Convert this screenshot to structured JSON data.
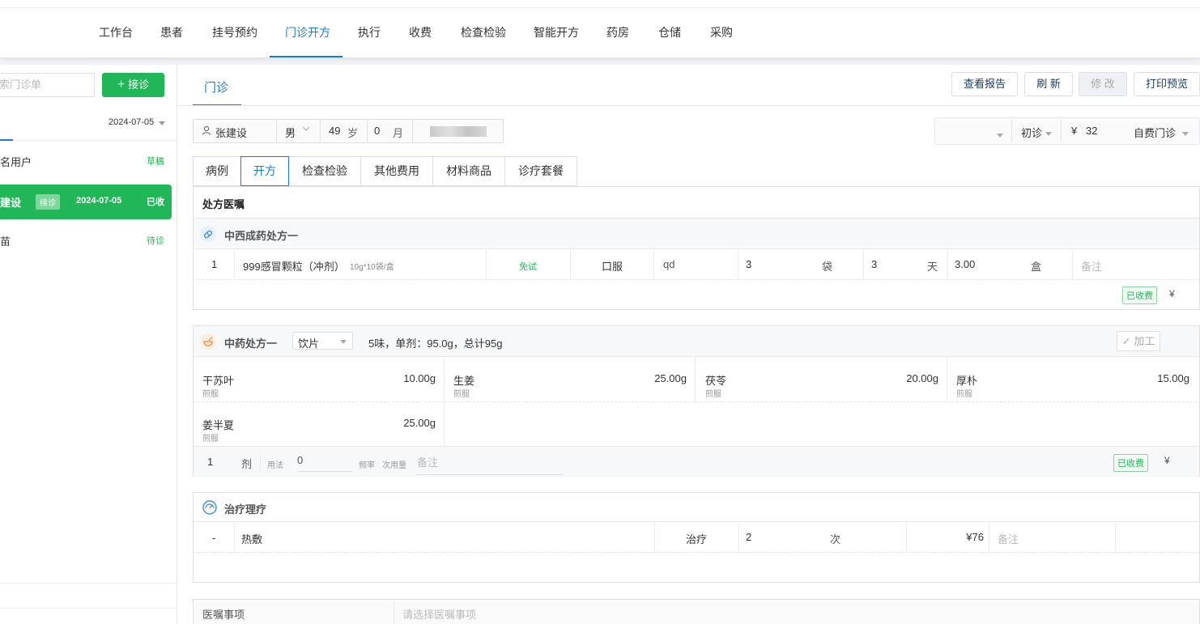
{
  "nav": {
    "items": [
      "工作台",
      "患者",
      "挂号预约",
      "门诊开方",
      "执行",
      "收费",
      "检查检验",
      "智能开方",
      "药房",
      "仓储",
      "采购"
    ],
    "active_index": 3
  },
  "sidebar": {
    "search_placeholder": "搜索门诊单",
    "receive_label": "接诊",
    "date": "2024-07-05",
    "patients": [
      {
        "name": "匿名用户",
        "status": "草稿"
      },
      {
        "name": "张建设",
        "badge": "续诊",
        "date": "2024-07-05",
        "status": "已收"
      },
      {
        "name": "张苗",
        "status": "待诊"
      }
    ]
  },
  "main": {
    "tab": "门诊",
    "buttons": {
      "report": "查看报告",
      "refresh": "刷 新",
      "modify": "修 改",
      "print": "打印预览"
    },
    "patient": {
      "name": "张建设",
      "sex": "男",
      "age": "49",
      "age_unit": "岁",
      "months": "0",
      "month_unit": "月"
    },
    "visit": {
      "type": "初诊",
      "fee_symbol": "¥",
      "fee": "32",
      "payment": "自费门诊"
    },
    "subtabs": [
      "病例",
      "开方",
      "检查检验",
      "其他费用",
      "材料商品",
      "诊疗套餐"
    ],
    "active_subtab": 1,
    "section_title": "处方医嘱",
    "western": {
      "title": "中西成药处方一",
      "row": {
        "no": "1",
        "name": "999感冒颗粒（冲剂）",
        "spec": "10g*10袋/盒",
        "skin_test": "免试",
        "route": "口服",
        "freq": "qd",
        "dose": "3",
        "dose_unit": "袋",
        "days": "3",
        "days_unit": "天",
        "qty": "3.00",
        "qty_unit": "盒",
        "remark_placeholder": "备注"
      },
      "paid": "已收费",
      "currency": "¥"
    },
    "chinese": {
      "title": "中药处方一",
      "form": "饮片",
      "summary": "5味，单剂：95.0g，总计95g",
      "process_label": "加工",
      "herbs": [
        {
          "name": "干苏叶",
          "usage": "煎服",
          "weight": "10.00g"
        },
        {
          "name": "生姜",
          "usage": "煎服",
          "weight": "25.00g"
        },
        {
          "name": "茯苓",
          "usage": "煎服",
          "weight": "20.00g"
        },
        {
          "name": "厚朴",
          "usage": "煎服",
          "weight": "15.00g"
        },
        {
          "name": "姜半夏",
          "usage": "煎服",
          "weight": "25.00g"
        }
      ],
      "footer": {
        "doses": "1",
        "dose_unit": "剂",
        "method": "用法",
        "amount": "0",
        "freq": "频率",
        "per_dose": "次用量",
        "remark": "备注"
      },
      "paid": "已收费",
      "currency": "¥"
    },
    "therapy": {
      "title": "治疗理疗",
      "row": {
        "no": "-",
        "name": "热敷",
        "type": "治疗",
        "count": "2",
        "unit": "次",
        "price": "¥76",
        "remark_placeholder": "备注"
      }
    },
    "orders": {
      "label": "医嘱事项",
      "placeholder": "请选择医嘱事项"
    }
  }
}
